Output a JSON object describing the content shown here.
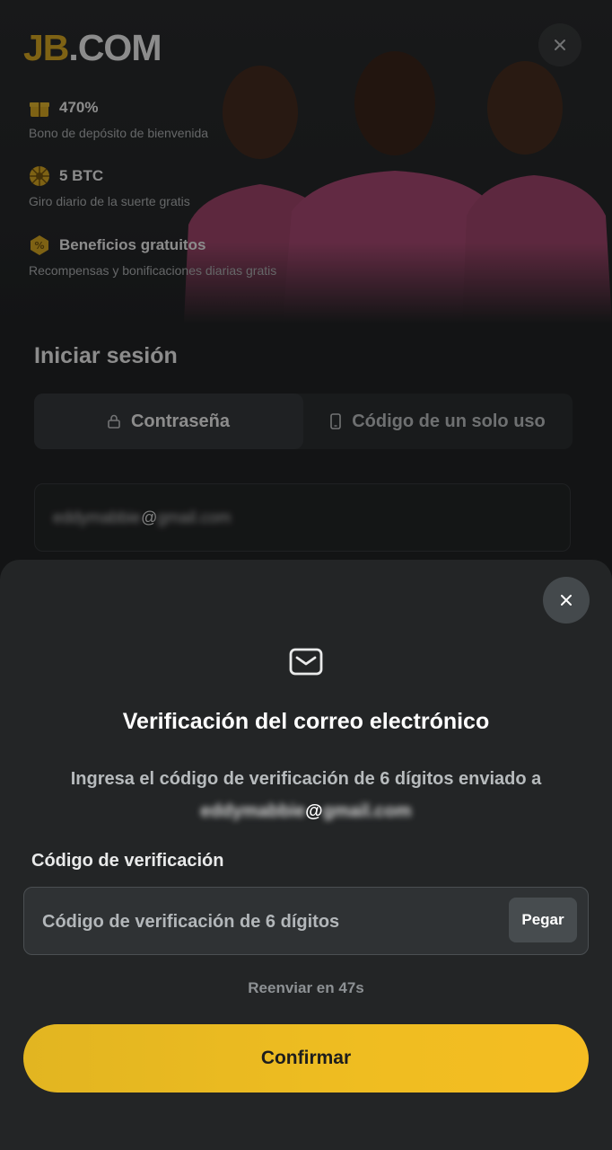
{
  "background": {
    "logo": {
      "brand": "JB",
      "suffix": ".COM"
    },
    "perks": [
      {
        "title": "470%",
        "subtitle": "Bono de depósito de bienvenida",
        "icon": "gift-icon"
      },
      {
        "title": "5 BTC",
        "subtitle": "Giro diario de la suerte gratis",
        "icon": "wheel-icon"
      },
      {
        "title": "Beneficios gratuitos",
        "subtitle": "Recompensas y bonificaciones diarias gratis",
        "icon": "coupon-icon"
      }
    ],
    "login": {
      "title": "Iniciar sesión",
      "tabs": [
        {
          "label": "Contraseña",
          "icon": "lock-icon",
          "active": true
        },
        {
          "label": "Código de un solo uso",
          "icon": "phone-icon",
          "active": false
        }
      ],
      "email_local": "eddymabbie",
      "email_at": "@",
      "email_domain": "gmail.com"
    }
  },
  "sheet": {
    "title": "Verificación del correo electrónico",
    "description": "Ingresa el código de verificación de 6 dígitos enviado a",
    "email_local": "eddymabbie",
    "email_at": "@",
    "email_domain": "gmail.com",
    "code_label": "Código de verificación",
    "code_placeholder": "Código de verificación de 6 dígitos",
    "paste_label": "Pegar",
    "resend_text": "Reenviar en 47s",
    "confirm_label": "Confirmar"
  },
  "colors": {
    "accent": "#efbd21",
    "brand_yellow": "#e6b325",
    "sheet_bg": "#232526"
  }
}
